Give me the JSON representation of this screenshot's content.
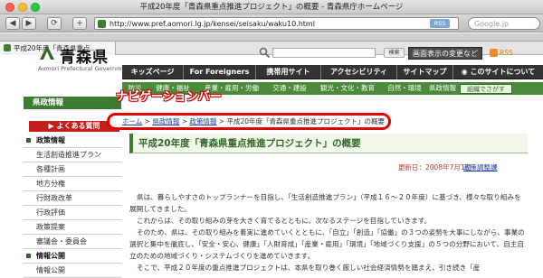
{
  "browser": {
    "window_title": "平成20年度「青森県重点推進プロジェクト」の概要 - 青森県庁ホームページ",
    "url": "http://www.pref.aomori.lg.jp/kensei/seisaku/waku10.html",
    "rss_badge": "RSS",
    "search_placeholder": "Google.jp",
    "tab_label": "平成20年度「青森県重点...",
    "nav_buttons": [
      "◀",
      "▶",
      "⟳",
      "+"
    ]
  },
  "header": {
    "site_name": "青森県",
    "site_subtitle": "Aomori Prefectural Government",
    "search_button": "検索",
    "display_button": "画面表示の変更など",
    "rss_label": "RSS"
  },
  "top_nav": [
    "キッズページ",
    "For Foreigners",
    "携帯用サイト",
    "アクセシビリティ",
    "サイトマップ",
    "このサイトについて"
  ],
  "category_nav": {
    "items": [
      "防災",
      "健康・福祉",
      "産業・雇用・労働",
      "交通・建設",
      "観光・文化・教育",
      "自然・環境",
      "県政情報"
    ],
    "enlarge_button": "組織でさがす"
  },
  "sidebar": {
    "header": "県政情報",
    "faq": "よくある質問",
    "items": [
      {
        "label": "政策情報",
        "head": true
      },
      {
        "label": "生活創造推進プラン",
        "head": false
      },
      {
        "label": "各種計画",
        "head": false
      },
      {
        "label": "地方分権",
        "head": false
      },
      {
        "label": "行財政改革",
        "head": false
      },
      {
        "label": "行政評価",
        "head": false
      },
      {
        "label": "政策提案",
        "head": false
      },
      {
        "label": "審議会・委員会",
        "head": false
      },
      {
        "label": "情報公開",
        "head": true
      },
      {
        "label": "情報公開",
        "head": false
      }
    ]
  },
  "annotation": {
    "callout": "ナビゲーションバー"
  },
  "breadcrumb": {
    "items": [
      "ホーム",
      "県政情報",
      "政策情報"
    ],
    "separator": " > ",
    "current": "平成20年度「青森県重点推進プロジェクト」の概要"
  },
  "main": {
    "title": "平成20年度「青森県重点推進プロジェクト」の概要",
    "updated": "更新日：2008年7月1日",
    "department": "政策調整課",
    "paragraphs": [
      "県は、暮らしやすさのトップランナーを目指し、「生活創造推進プラン」（平成１６～２０年度）に基づき、様々な取り組みを展開してきました。",
      "これからは、その取り組みの芽を大きく育てるとともに、次なるステージを目指していきます。",
      "そのため、県は、その取り組みを着実に進めていくとともに、「自立」「創造」「協働」の３つの姿勢を大事にしながら、事業の選択と集中を徹底し、「安全・安心、健康」「人財育成」「産業・雇用」「環境」「地域づくり支援」の５つの分野において、自主自立のための地域づくり・システムづくりを進めていきます。",
      "そこで、平成２０年度の重点推進プロジェクトは、本県を取り巻く厳しい社会経済情勢を踏まえ、引き続き「産"
    ]
  }
}
